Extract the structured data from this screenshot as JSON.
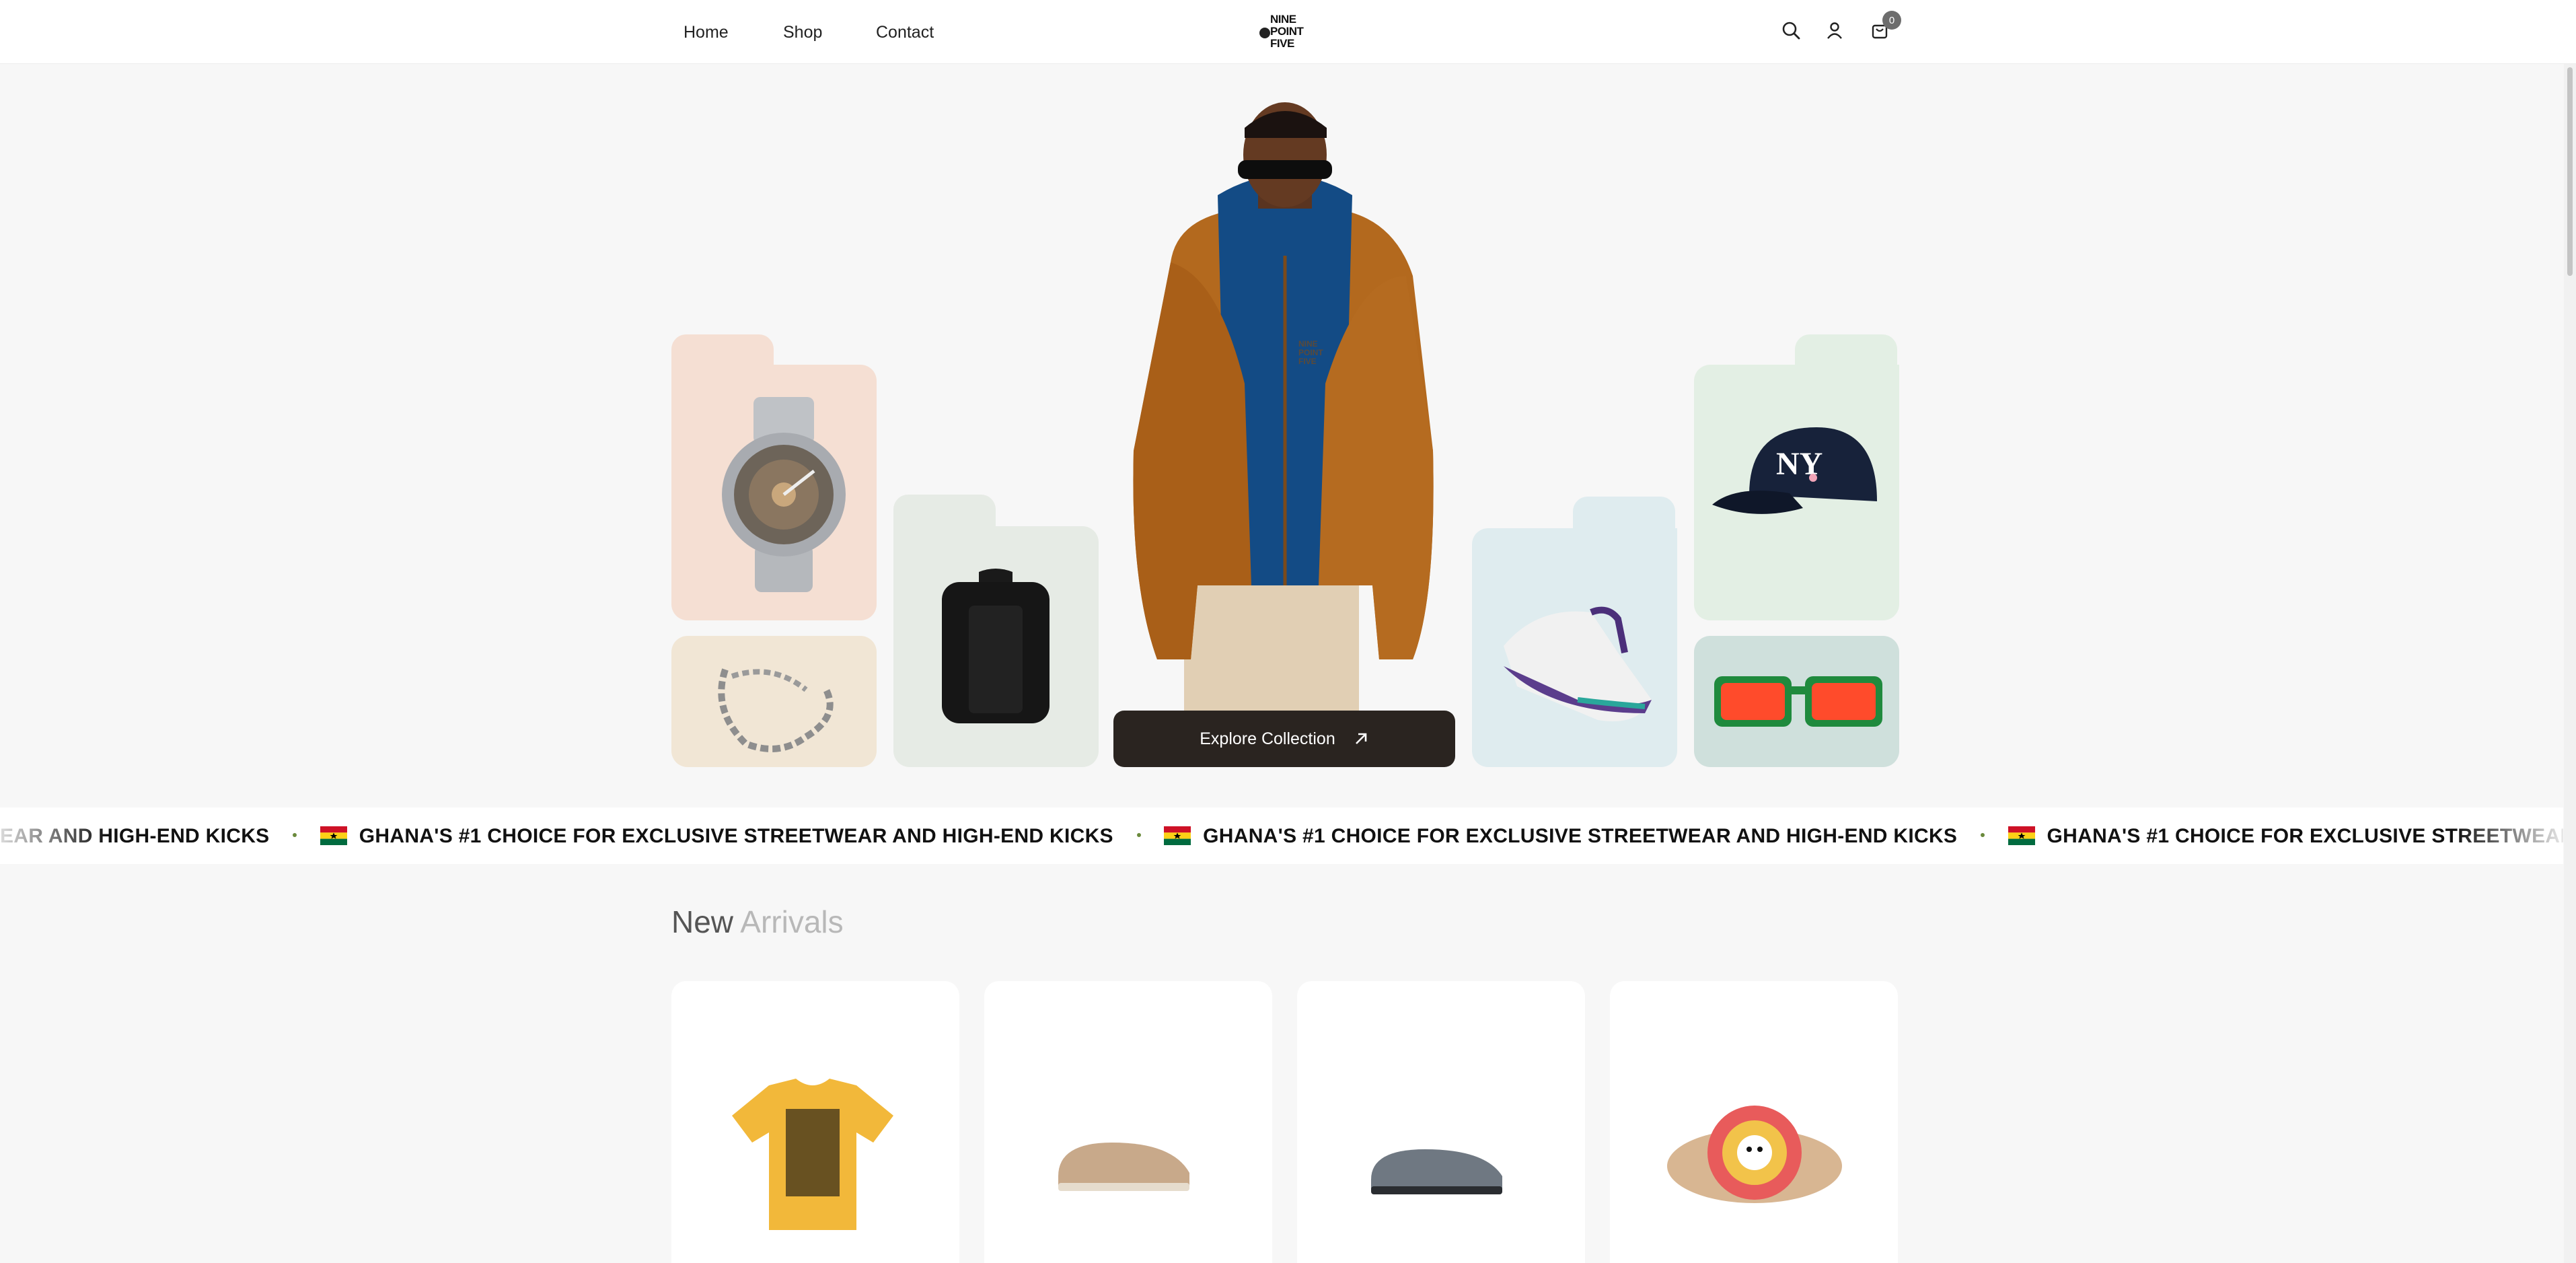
{
  "header": {
    "nav": [
      "Home",
      "Shop",
      "Contact"
    ],
    "logo": [
      "NINE",
      "POINT",
      "FIVE"
    ],
    "cart_count": "0"
  },
  "hero": {
    "cta_label": "Explore Collection",
    "jacket_logo": "NINE POINT FIVE"
  },
  "marquee": {
    "text": "GHANA'S #1 CHOICE FOR EXCLUSIVE STREETWEAR AND HIGH-END KICKS",
    "lead_text": "EAR AND HIGH-END KICKS"
  },
  "new_arrivals": {
    "title_a": "New",
    "title_b": "Arrivals"
  },
  "colors": {
    "card_peach": "#f5dfd3",
    "card_cream": "#f1e6d5",
    "card_sage": "#e6ebe5",
    "card_blue": "#dfecef",
    "card_mint": "#e3efe4",
    "card_teal": "#cfe0dc",
    "cta": "#2a2420"
  }
}
